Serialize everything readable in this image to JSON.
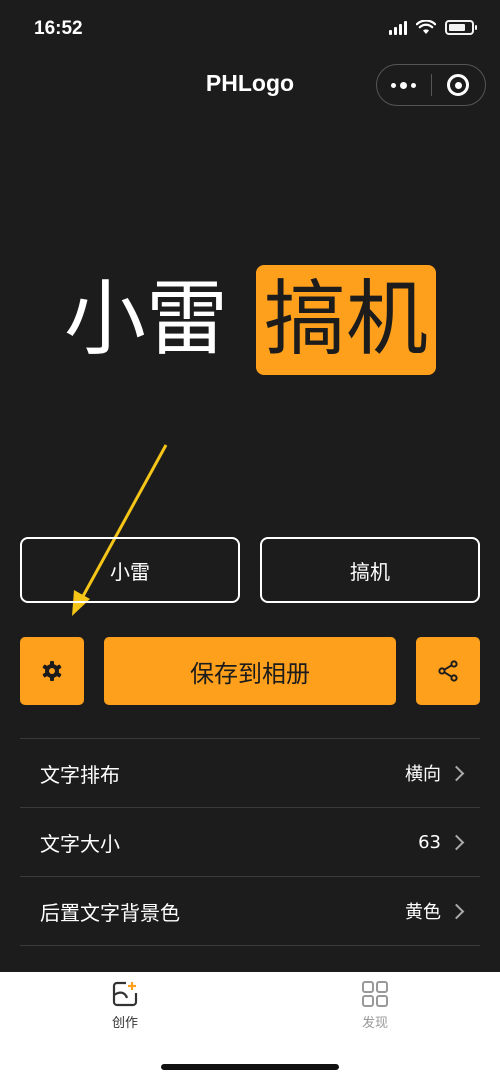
{
  "status_bar": {
    "time": "16:52"
  },
  "nav": {
    "title": "PHLogo"
  },
  "logo_preview": {
    "text1": "小雷",
    "text2": "搞机",
    "highlight_color": "#ffa01c"
  },
  "inputs": {
    "left_value": "小雷",
    "right_value": "搞机"
  },
  "actions": {
    "settings_icon": "gear-icon",
    "save_label": "保存到相册",
    "share_icon": "share-icon"
  },
  "settings": [
    {
      "label": "文字排布",
      "value": "横向"
    },
    {
      "label": "文字大小",
      "value": "63"
    },
    {
      "label": "后置文字背景色",
      "value": "黄色"
    }
  ],
  "tab_bar": {
    "tabs": [
      {
        "label": "创作",
        "icon": "create-icon",
        "active": true
      },
      {
        "label": "发现",
        "icon": "grid-icon",
        "active": false
      }
    ]
  },
  "colors": {
    "background": "#1c1c1c",
    "accent": "#ffa01c",
    "annotation_arrow": "#f5c518"
  }
}
